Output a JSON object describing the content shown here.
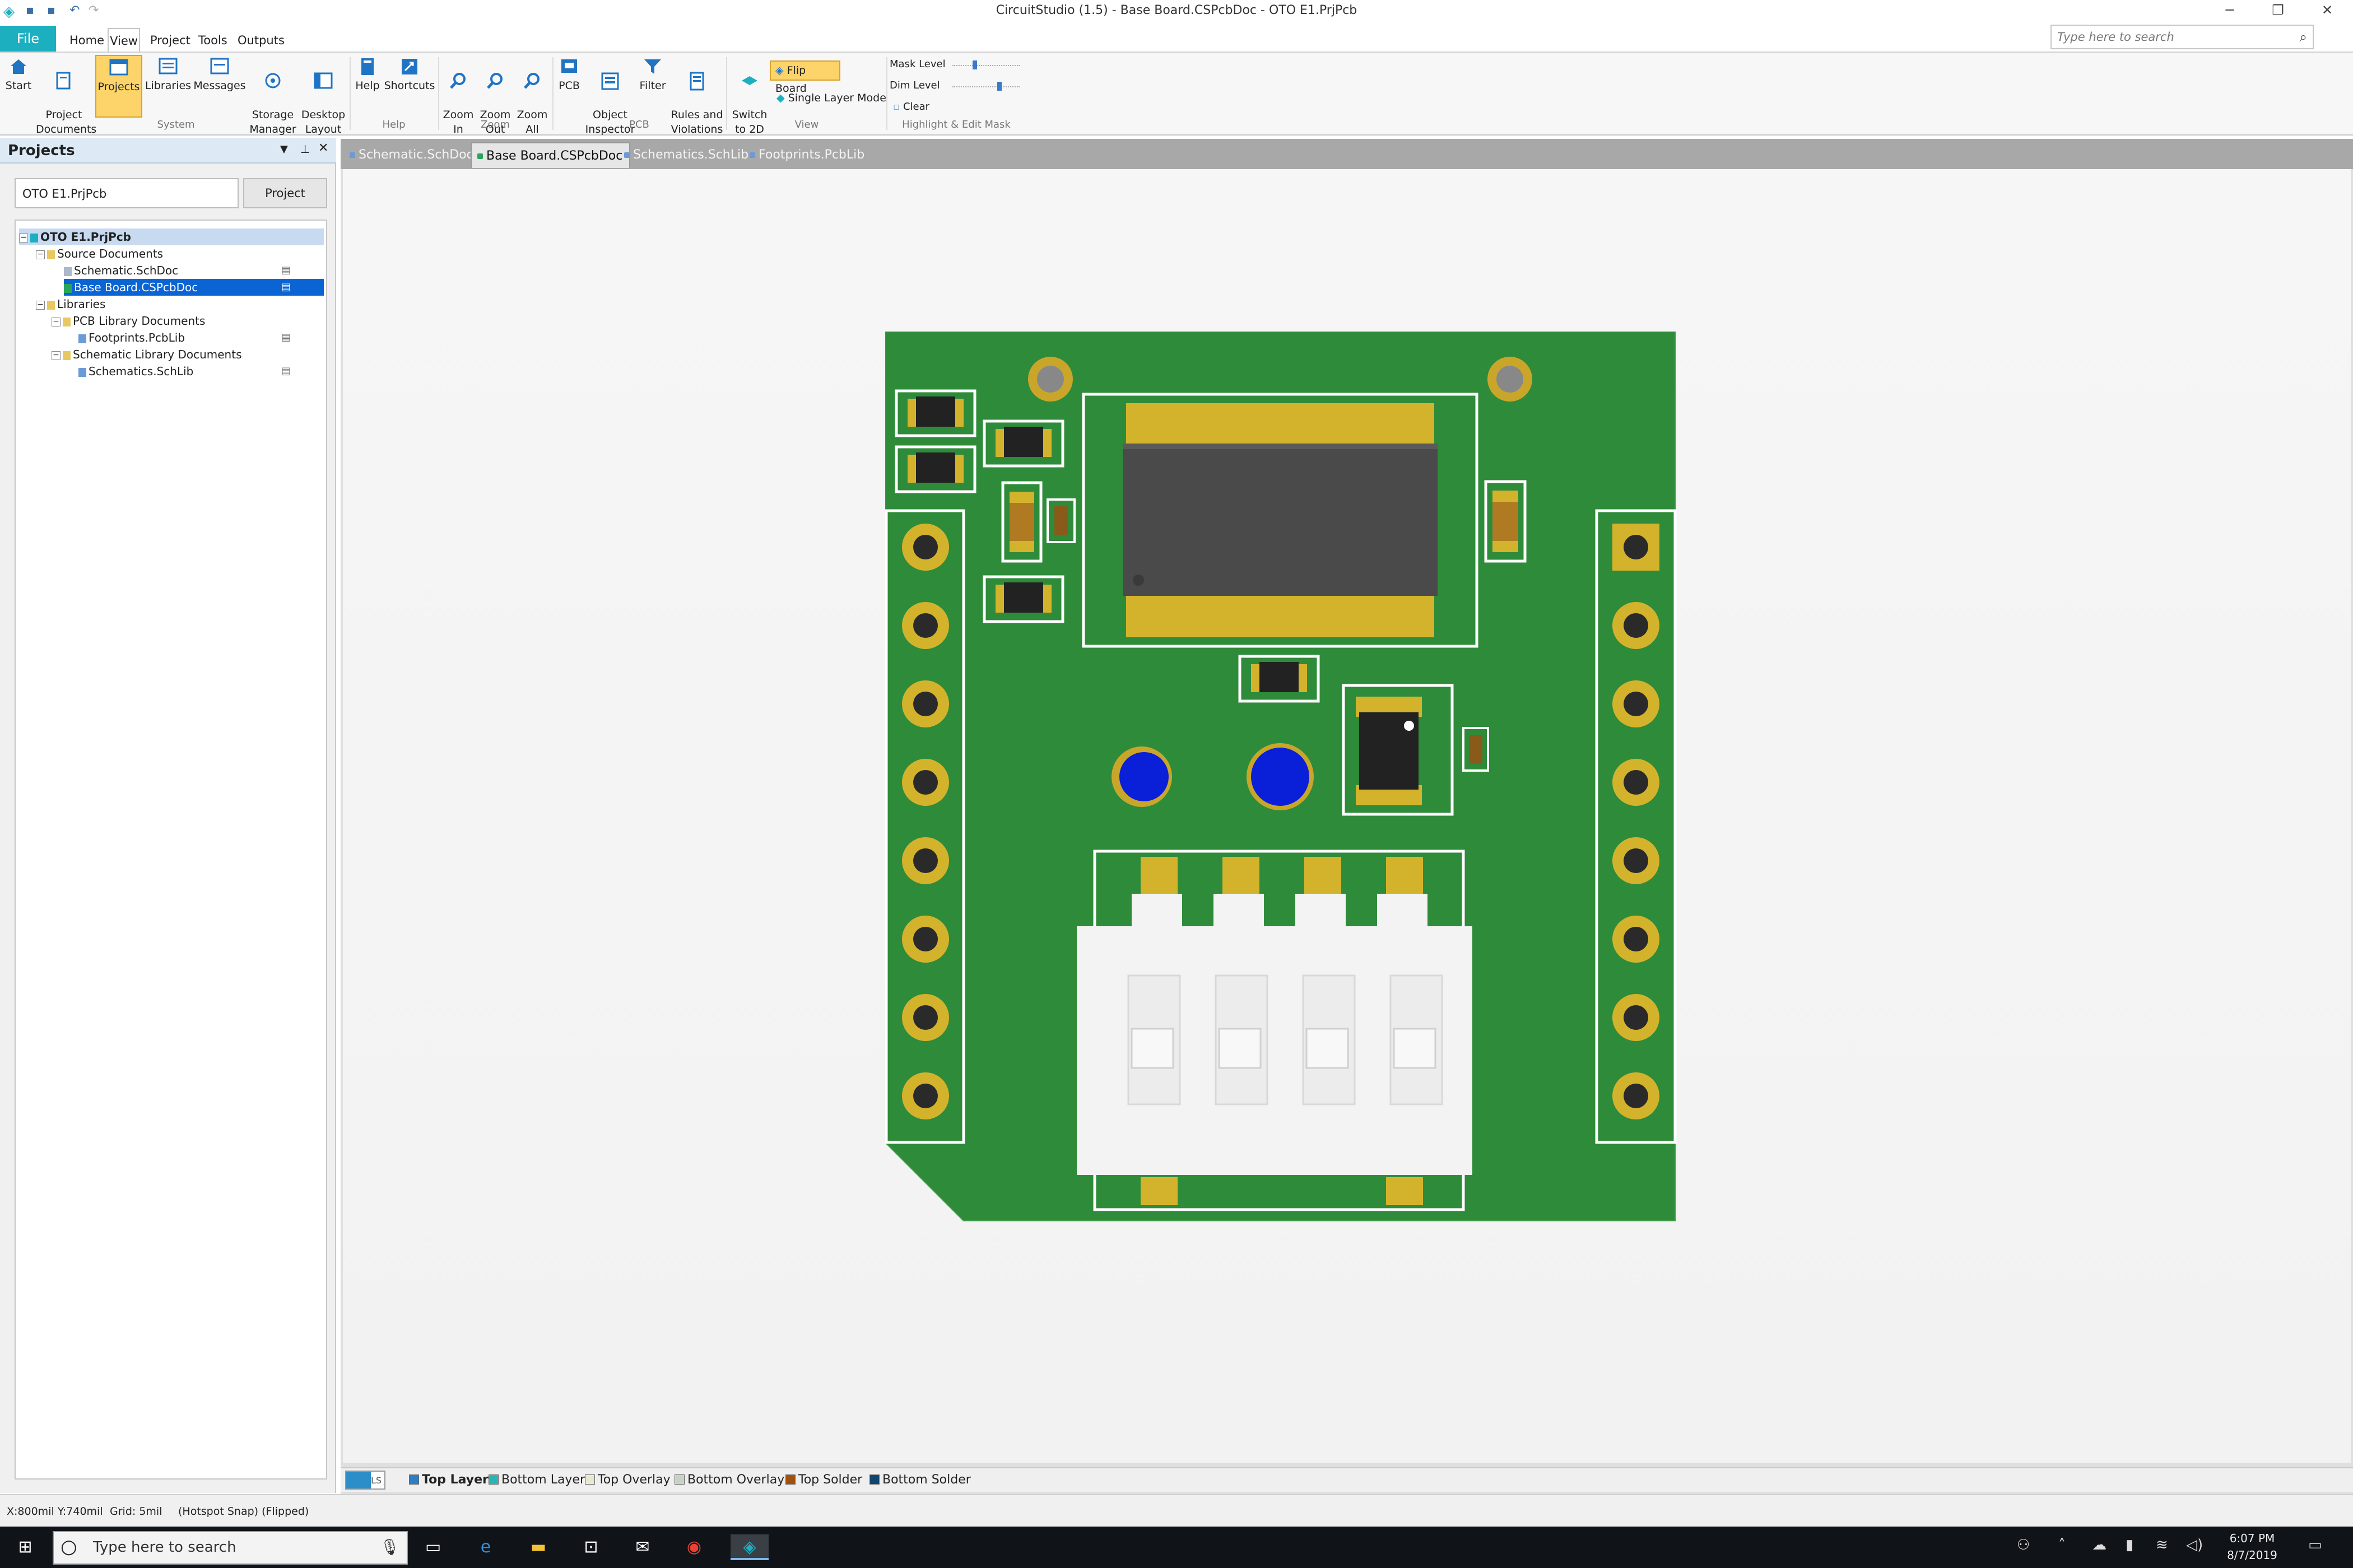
{
  "window": {
    "title": "CircuitStudio (1.5) - Base Board.CSPcbDoc - OTO E1.PrjPcb",
    "minimize": "─",
    "restore": "❐",
    "close": "✕",
    "search_placeholder": "Type here to search"
  },
  "menubar": {
    "file": "File",
    "items": [
      "Home",
      "View",
      "Project",
      "Tools",
      "Outputs"
    ]
  },
  "ribbon": {
    "buttons": {
      "start": "Start",
      "project_documents": "Project\nDocuments",
      "projects": "Projects",
      "libraries": "Libraries",
      "messages": "Messages",
      "storage_manager": "Storage\nManager",
      "desktop_layout": "Desktop\nLayout",
      "help": "Help",
      "shortcuts": "Shortcuts",
      "zoom_in": "Zoom\nIn",
      "zoom_out": "Zoom\nOut",
      "zoom_all": "Zoom\nAll",
      "pcb": "PCB",
      "object_inspector": "Object\nInspector",
      "filter": "Filter",
      "rules_violations": "Rules and\nViolations",
      "switch_2d": "Switch\nto 2D",
      "flip_board": "Flip Board",
      "single_layer": "Single Layer Mode",
      "mask_level": "Mask Level",
      "dim_level": "Dim Level",
      "clear": "Clear"
    },
    "groups": {
      "system": "System",
      "help": "Help",
      "zoom": "Zoom",
      "pcb": "PCB",
      "view": "View",
      "highlight": "Highlight & Edit Mask"
    }
  },
  "projects_panel": {
    "title": "Projects",
    "input_value": "OTO E1.PrjPcb",
    "project_button": "Project",
    "tree": {
      "root": "OTO E1.PrjPcb",
      "source_documents": "Source Documents",
      "schematic_doc": "Schematic.SchDoc",
      "base_board": "Base Board.CSPcbDoc",
      "libraries": "Libraries",
      "pcb_lib_docs": "PCB Library Documents",
      "footprints": "Footprints.PcbLib",
      "sch_lib_docs": "Schematic Library Documents",
      "schematics": "Schematics.SchLib"
    }
  },
  "document_tabs": [
    "Schematic.SchDoc",
    "Base Board.CSPcbDoc",
    "Schematics.SchLib",
    "Footprints.PcbLib"
  ],
  "layers": {
    "ls": "LS",
    "items": [
      {
        "label": "Top Layer",
        "color": "#2b7fc2"
      },
      {
        "label": "Bottom Layer",
        "color": "#2ab5b5"
      },
      {
        "label": "Top Overlay",
        "color": "#e8e8d0"
      },
      {
        "label": "Bottom Overlay",
        "color": "#c8d0c8"
      },
      {
        "label": "Top Solder",
        "color": "#a0520a"
      },
      {
        "label": "Bottom Solder",
        "color": "#10456e"
      }
    ]
  },
  "status": {
    "coords": "X:800mil Y:740mil",
    "grid": "Grid: 5mil",
    "snap": "(Hotspot Snap) (Flipped)"
  },
  "taskbar": {
    "search": "Type here to search",
    "time": "6:07 PM",
    "date": "8/7/2019"
  }
}
